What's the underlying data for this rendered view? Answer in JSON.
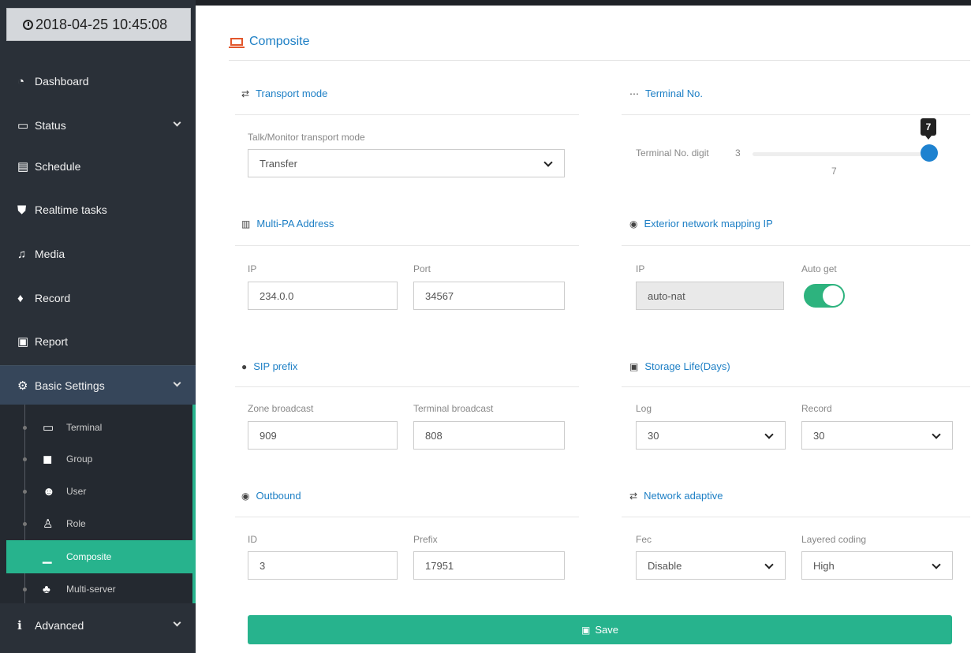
{
  "clock": "2018-04-25 10:45:08",
  "sidebar": {
    "items": [
      {
        "label": "Dashboard",
        "icon": "dashboard-icon"
      },
      {
        "label": "Status",
        "icon": "status-icon"
      },
      {
        "label": "Schedule",
        "icon": "schedule-icon"
      },
      {
        "label": "Realtime tasks",
        "icon": "shield-icon"
      },
      {
        "label": "Media",
        "icon": "music-icon"
      },
      {
        "label": "Record",
        "icon": "microphone-icon"
      },
      {
        "label": "Report",
        "icon": "report-icon"
      },
      {
        "label": "Basic Settings",
        "icon": "gear-icon"
      },
      {
        "label": "Advanced",
        "icon": "info-icon"
      }
    ],
    "submenu": [
      {
        "label": "Terminal",
        "icon": "monitor-icon"
      },
      {
        "label": "Group",
        "icon": "group-icon"
      },
      {
        "label": "User",
        "icon": "users-icon"
      },
      {
        "label": "Role",
        "icon": "role-icon"
      },
      {
        "label": "Composite",
        "icon": "laptop-icon"
      },
      {
        "label": "Multi-server",
        "icon": "sitemap-icon"
      }
    ]
  },
  "page": {
    "title": "Composite"
  },
  "transport": {
    "title": "Transport mode",
    "field_label": "Talk/Monitor transport mode",
    "value": "Transfer"
  },
  "terminal": {
    "title": "Terminal No.",
    "label": "Terminal No. digit",
    "min": "3",
    "value": "7",
    "tip": "7"
  },
  "multipa": {
    "title": "Multi-PA Address",
    "ip_label": "IP",
    "ip_value": "234.0.0",
    "port_label": "Port",
    "port_value": "34567"
  },
  "exterior": {
    "title": "Exterior network mapping IP",
    "ip_label": "IP",
    "ip_value": "auto-nat",
    "auto_label": "Auto get",
    "auto_on": true
  },
  "sip": {
    "title": "SIP prefix",
    "zone_label": "Zone broadcast",
    "zone_value": "909",
    "terminal_label": "Terminal broadcast",
    "terminal_value": "808"
  },
  "storage": {
    "title": "Storage Life(Days)",
    "log_label": "Log",
    "log_value": "30",
    "record_label": "Record",
    "record_value": "30"
  },
  "outbound": {
    "title": "Outbound",
    "id_label": "ID",
    "id_value": "3",
    "prefix_label": "Prefix",
    "prefix_value": "17951"
  },
  "network": {
    "title": "Network adaptive",
    "fec_label": "Fec",
    "fec_value": "Disable",
    "layered_label": "Layered coding",
    "layered_value": "High"
  },
  "save_label": "Save",
  "colors": {
    "accent": "#27b38d",
    "link": "#1d7fc5",
    "sidebar": "#2a3038"
  }
}
